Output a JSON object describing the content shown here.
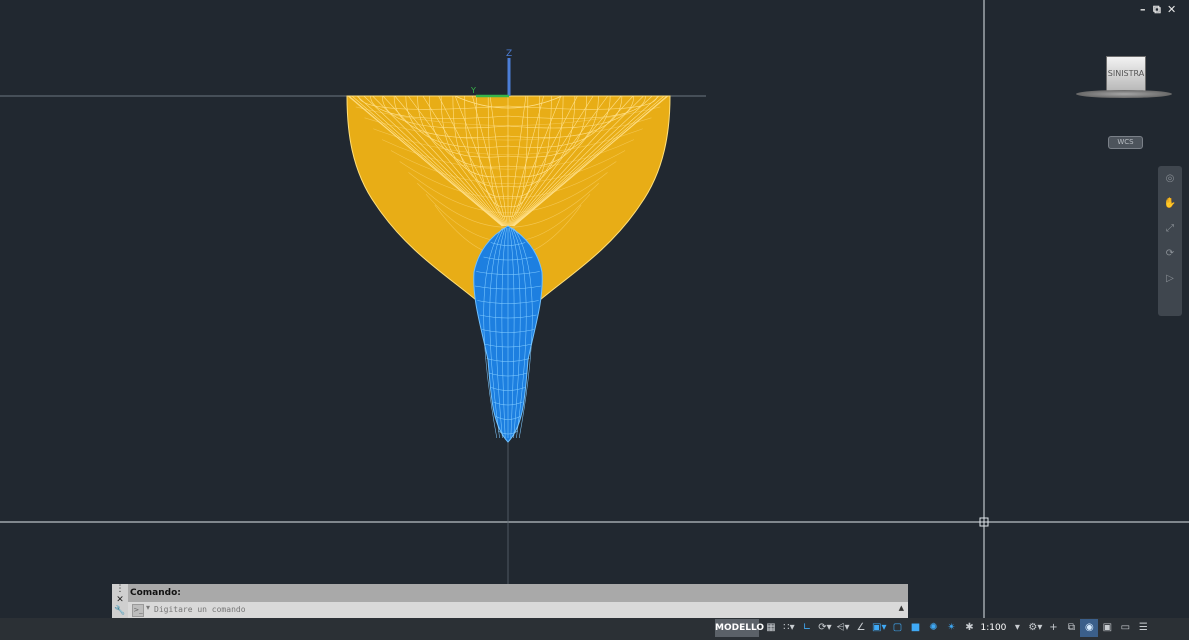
{
  "window": {
    "minimize_icon": "minimize-icon",
    "restore_icon": "restore-icon",
    "close_icon": "close-icon"
  },
  "viewcube": {
    "face_label": "SINISTRA",
    "wcs_label": "WCS"
  },
  "ucs": {
    "z_label": "Z",
    "y_label": "Y"
  },
  "navbar": {
    "icons": [
      "steering-wheel-icon",
      "pan-icon",
      "zoom-extents-icon",
      "orbit-icon",
      "showmotion-icon"
    ]
  },
  "model": {
    "hull_color": "#e8ad16",
    "hull_line_color": "#ffdf7a",
    "keel_color": "#1d7fe0",
    "keel_line_color": "#6fc0ff",
    "background_color": "#212830"
  },
  "command": {
    "history": "Comando:",
    "placeholder": "Digitare un comando",
    "close_icon": "close-icon",
    "settings_icon": "wrench-icon",
    "prompt_icon": "command-prompt-icon"
  },
  "status": {
    "mode": "MODELLO",
    "scale": "1:100",
    "icons": [
      "grid-icon",
      "snap-icon",
      "ortho-icon",
      "polar-icon",
      "isodraft-icon",
      "osnap-icon",
      "otrack-icon",
      "lineweight-icon",
      "transparency-icon",
      "selection-cycling-icon",
      "dynamic-ucs-icon",
      "annotation-visibility-icon",
      "auto-scale-icon",
      "workspace-icon",
      "plus-icon",
      "isolate-icon",
      "hardware-acceleration-icon",
      "clean-screen-icon",
      "customize-icon"
    ]
  }
}
